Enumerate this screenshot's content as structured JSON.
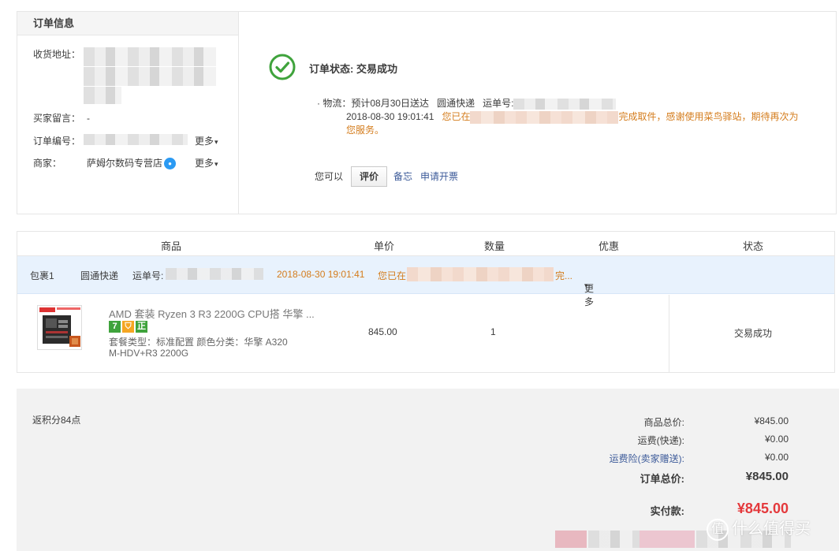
{
  "order_info": {
    "header": "订单信息",
    "address_label": "收货地址：",
    "message_label": "买家留言：",
    "message_value": "-",
    "order_no_label": "订单编号：",
    "merchant_label": "商家：",
    "merchant_name": "萨姆尔数码专营店",
    "more_label": "更多"
  },
  "status": {
    "title": "订单状态: 交易成功",
    "logistics_prefix": "· 物流：",
    "eta": "预计08月30日送达",
    "carrier": "圆通快递",
    "tracking_label": "运单号:",
    "timestamp": "2018-08-30 19:01:41",
    "msg_start": "您已在",
    "msg_end": "完成取件，感谢使用菜鸟驿站，期待再次为",
    "msg_end2": "您服务。",
    "you_can": "您可以",
    "review_btn": "评价",
    "memo_link": "备忘",
    "invoice_link": "申请开票"
  },
  "table": {
    "headers": [
      "商品",
      "单价",
      "数量",
      "优惠",
      "状态"
    ],
    "package": {
      "name": "包裹1",
      "carrier": "圆通快递",
      "tracking_label": "运单号:",
      "timestamp": "2018-08-30 19:01:41",
      "msg_start": "您已在",
      "msg_end": "完...",
      "more": "更多"
    },
    "item": {
      "title": "AMD 套装 Ryzen 3 R3 2200G CPU搭 华擎 ...",
      "badges": [
        "7",
        "",
        "正"
      ],
      "spec_line1": "套餐类型：标准配置 颜色分类：华擎 A320",
      "spec_line2": "M-HDV+R3 2200G",
      "price": "845.00",
      "qty": "1",
      "status": "交易成功"
    }
  },
  "summary": {
    "points": "返积分84点",
    "goods_total_label": "商品总价:",
    "goods_total": "¥845.00",
    "shipping_label": "运费(快递):",
    "shipping": "¥0.00",
    "insurance_label": "运费险(卖家赠送):",
    "insurance": "¥0.00",
    "order_total_label": "订单总价:",
    "order_total": "¥845.00",
    "paid_label": "实付款:",
    "paid": "¥845.00"
  },
  "watermark": "什么值得买",
  "colors": {
    "accent_green": "#3fa33c",
    "orange": "#d47c1c",
    "link_blue": "#3c5a99",
    "price_red": "#e4393c",
    "package_bg": "#e8f2fd"
  }
}
